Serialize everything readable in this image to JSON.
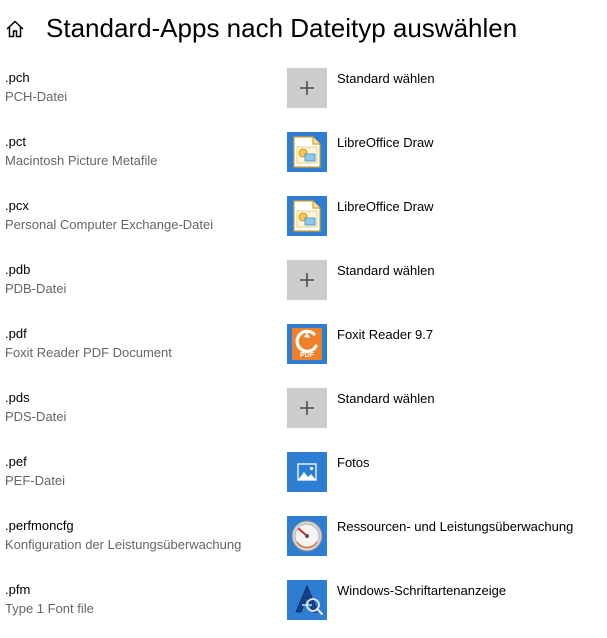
{
  "header": {
    "title": "Standard-Apps nach Dateityp auswählen",
    "home_icon": "home-icon"
  },
  "rows": [
    {
      "ext": ".pch",
      "desc": "PCH-Datei",
      "app": "Standard wählen",
      "icon": "plus-icon"
    },
    {
      "ext": ".pct",
      "desc": "Macintosh Picture Metafile",
      "app": "LibreOffice Draw",
      "icon": "libreoffice-draw-icon"
    },
    {
      "ext": ".pcx",
      "desc": "Personal Computer Exchange-Datei",
      "app": "LibreOffice Draw",
      "icon": "libreoffice-draw-icon"
    },
    {
      "ext": ".pdb",
      "desc": "PDB-Datei",
      "app": "Standard wählen",
      "icon": "plus-icon"
    },
    {
      "ext": ".pdf",
      "desc": "Foxit Reader PDF Document",
      "app": "Foxit Reader 9.7",
      "icon": "foxit-reader-icon",
      "icon_text": "PDF"
    },
    {
      "ext": ".pds",
      "desc": "PDS-Datei",
      "app": "Standard wählen",
      "icon": "plus-icon"
    },
    {
      "ext": ".pef",
      "desc": "PEF-Datei",
      "app": "Fotos",
      "icon": "photos-icon"
    },
    {
      "ext": ".perfmoncfg",
      "desc": "Konfiguration der Leistungsüberwachung",
      "app": "Ressourcen- und Leistungsüberwachung",
      "icon": "performance-monitor-icon"
    },
    {
      "ext": ".pfm",
      "desc": "Type 1 Font file",
      "app": "Windows-Schriftartenanzeige",
      "icon": "font-viewer-icon"
    }
  ],
  "colors": {
    "accent": "#2d7dd2",
    "choose_tile": "#cccccc",
    "secondary_text": "#666666",
    "foxit_orange": "#f0812a"
  }
}
